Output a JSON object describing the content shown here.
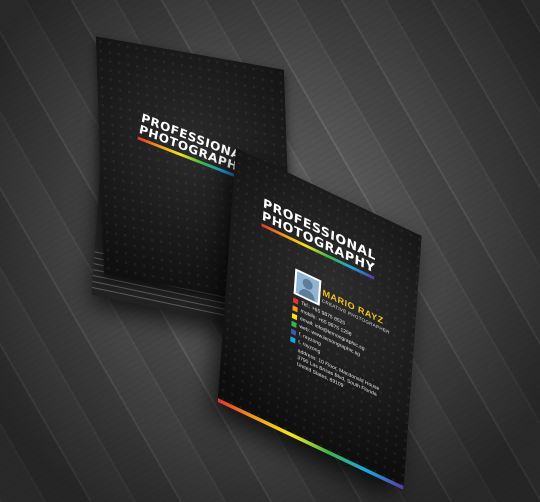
{
  "back_card": {
    "logo_line1": "PROFESSIONAL",
    "logo_line2": "PHOTOGRAPHY"
  },
  "front_card": {
    "logo_line1": "PROFESSIONAL",
    "logo_line2": "PHOTOGRAPHY",
    "name": "MARIO RAYZ",
    "title": "CREATIVE PHOTOGRAPHER",
    "contacts": [
      {
        "icon": "phone-icon",
        "color": "#e53131",
        "text": "Tel.: +65 9875 8525"
      },
      {
        "icon": "mobile-icon",
        "color": "#f29b18",
        "text": "mobile: +65 9875 1258"
      },
      {
        "icon": "email-icon",
        "color": "#f6e51c",
        "text": "email: info@lemongraphic.sg"
      },
      {
        "icon": "web-icon",
        "color": "#3bb54a",
        "text": "web: www.lemongraphic.sg"
      },
      {
        "icon": "facebook-icon",
        "color": "#3b5bb0",
        "text": "f. rayzong"
      },
      {
        "icon": "twitter-icon",
        "color": "#1ca6e0",
        "text": "t. rayzong"
      }
    ],
    "address_line1": "address: 10 Floor, Macdonald House",
    "address_line2": "3790 Las Brisas Blvd, South Florida",
    "address_line3": "United States, 89109"
  },
  "colors": {
    "accent_name": "#f4c319",
    "rainbow": [
      "#e53131",
      "#f29b18",
      "#f6e51c",
      "#3bb54a",
      "#1ca6e0",
      "#5c3aa6"
    ]
  }
}
